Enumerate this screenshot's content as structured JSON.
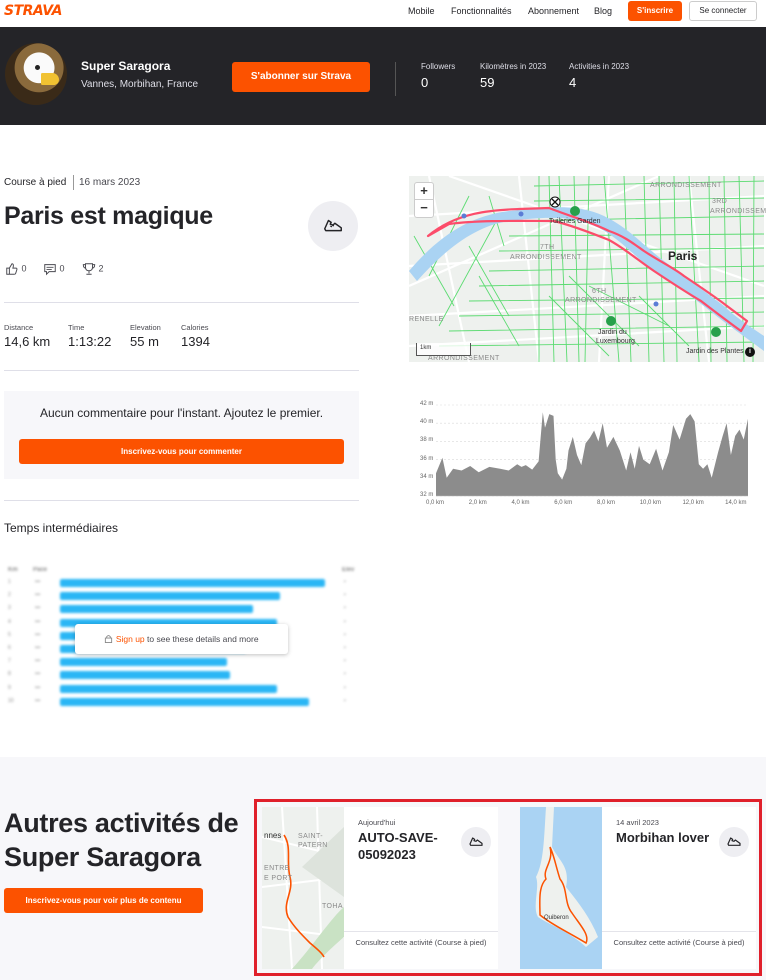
{
  "nav": {
    "logo": "STRAVA",
    "links": [
      "Mobile",
      "Fonctionnalités",
      "Abonnement",
      "Blog"
    ],
    "signup": "S'inscrire",
    "login": "Se connecter"
  },
  "athlete": {
    "name": "Super Saragora",
    "location": "Vannes, Morbihan, France",
    "follow_button": "S'abonner sur Strava",
    "stats": [
      {
        "label": "Followers",
        "value": "0"
      },
      {
        "label": "Kilomètres in 2023",
        "value": "59"
      },
      {
        "label": "Activities in 2023",
        "value": "4"
      }
    ]
  },
  "activity": {
    "type": "Course à pied",
    "date": "16 mars 2023",
    "title": "Paris est magique",
    "kudos": "0",
    "comments": "0",
    "achievements": "2",
    "metrics": [
      {
        "label": "Distance",
        "value": "14,6 km"
      },
      {
        "label": "Time",
        "value": "1:13:22"
      },
      {
        "label": "Elevation",
        "value": "55 m"
      },
      {
        "label": "Calories",
        "value": "1394"
      }
    ]
  },
  "comments": {
    "empty_text": "Aucun commentaire pour l'instant. Ajoutez le premier.",
    "button": "Inscrivez-vous pour commenter"
  },
  "splits": {
    "title": "Temps intermédiaires",
    "overlay_link": "Sign up",
    "overlay_text": " to see these details and more",
    "bar_fraction": [
      1.0,
      0.83,
      0.73,
      0.82,
      0.68,
      0.7,
      0.63,
      0.64,
      0.82,
      0.94
    ]
  },
  "map": {
    "labels": {
      "arr_top": "ARRONDISSEMENT",
      "third": "3RD",
      "seventh": "7TH",
      "sixth": "6TH",
      "renelle": "RENELLE",
      "tuileries": "Tuileries Garden",
      "paris": "Paris",
      "luxembourg_1": "Jardin du",
      "luxembourg_2": "Luxembourg",
      "plantes": "Jardin des Plantes"
    },
    "scale": "1km",
    "zoom_in": "+",
    "zoom_out": "−",
    "info": "i"
  },
  "elevation_chart": {
    "type": "area",
    "y_ticks": [
      "42 m",
      "40 m",
      "38 m",
      "36 m",
      "34 m",
      "32 m"
    ],
    "x_ticks": [
      "0,0 km",
      "2,0 km",
      "4,0 km",
      "6,0 km",
      "8,0 km",
      "10,0 km",
      "12,0 km",
      "14,0 km"
    ],
    "ylim": [
      32,
      42
    ],
    "xlim": [
      0,
      14.6
    ],
    "x": [
      0,
      0.3,
      0.5,
      0.8,
      1.2,
      1.6,
      2.0,
      2.5,
      3.0,
      3.4,
      3.8,
      4.0,
      4.2,
      4.5,
      4.8,
      5.0,
      5.1,
      5.3,
      5.5,
      5.6,
      5.7,
      5.9,
      6.1,
      6.2,
      6.4,
      6.6,
      6.8,
      7.0,
      7.2,
      7.4,
      7.6,
      7.8,
      8.0,
      8.3,
      8.6,
      8.9,
      9.1,
      9.3,
      9.5,
      9.7,
      10.0,
      10.3,
      10.6,
      10.9,
      11.1,
      11.4,
      11.7,
      11.9,
      12.1,
      12.3,
      12.5,
      12.7,
      12.9,
      13.2,
      13.4,
      13.6,
      13.8,
      14.0,
      14.2,
      14.4,
      14.6
    ],
    "y": [
      34.5,
      36.2,
      34.0,
      35.0,
      34.8,
      35.3,
      34.6,
      35.2,
      35.0,
      34.8,
      35.5,
      35.2,
      35.4,
      34.9,
      35.8,
      41.2,
      39.5,
      41.0,
      40.8,
      36.0,
      34.5,
      33.8,
      35.0,
      37.0,
      38.5,
      36.5,
      35.4,
      37.8,
      38.4,
      39.2,
      38.0,
      40.0,
      37.3,
      38.5,
      37.0,
      34.8,
      36.8,
      35.0,
      37.5,
      36.0,
      35.5,
      37.2,
      34.8,
      36.8,
      39.8,
      38.2,
      40.5,
      41.0,
      40.2,
      35.5,
      35.0,
      35.5,
      34.0,
      36.8,
      38.5,
      40.0,
      36.5,
      38.6,
      39.3,
      38.2,
      40.5
    ]
  },
  "other": {
    "title": "Autres activités de Super Saragora",
    "button": "Inscrivez-vous pour voir plus de contenu",
    "cards": [
      {
        "date": "Aujourd'hui",
        "title": "AUTO-SAVE-05092023",
        "link": "Consultez cette activité (Course à pied)",
        "map_labels": [
          "nnes",
          "SAINT-",
          "PATERN",
          "ENTRE",
          "E PORT",
          "TOHA"
        ]
      },
      {
        "date": "14 avril 2023",
        "title": "Morbihan lover",
        "link": "Consultez cette activité (Course à pied)",
        "map_labels": [
          "Quiberon"
        ]
      }
    ]
  },
  "colors": {
    "brand": "#fc5200",
    "route": "#fc4c6a",
    "splits_bar": "#2ab6f5",
    "highlight": "#e0202b"
  }
}
